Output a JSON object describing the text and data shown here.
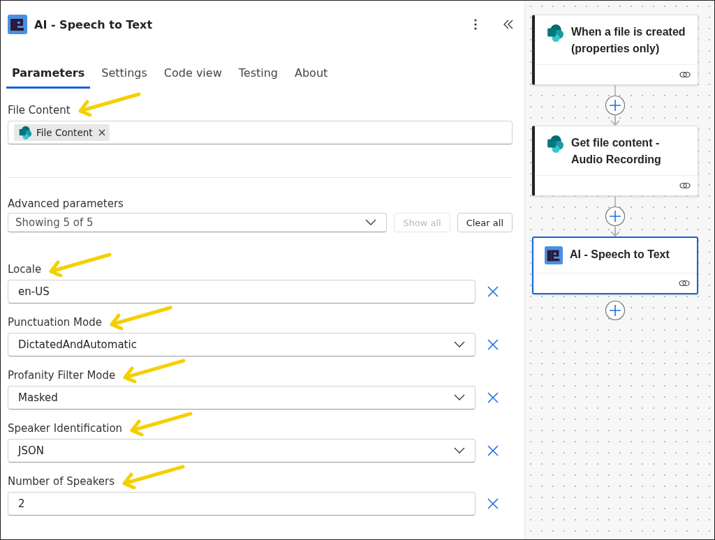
{
  "panel": {
    "title": "AI - Speech to Text"
  },
  "tabs": [
    {
      "label": "Parameters",
      "selected": true
    },
    {
      "label": "Settings",
      "selected": false
    },
    {
      "label": "Code view",
      "selected": false
    },
    {
      "label": "Testing",
      "selected": false
    },
    {
      "label": "About",
      "selected": false
    }
  ],
  "file_content": {
    "label": "File Content",
    "token": "File Content"
  },
  "advanced": {
    "label": "Advanced parameters",
    "value": "Showing 5 of 5",
    "show_all": {
      "label": "Show all",
      "disabled": true
    },
    "clear_all": {
      "label": "Clear all",
      "disabled": false
    }
  },
  "parameters": [
    {
      "label": "Locale",
      "kind": "text",
      "value": "en-US"
    },
    {
      "label": "Punctuation Mode",
      "kind": "dropdown",
      "value": "DictatedAndAutomatic"
    },
    {
      "label": "Profanity Filter Mode",
      "kind": "dropdown",
      "value": "Masked"
    },
    {
      "label": "Speaker Identification",
      "kind": "dropdown",
      "value": "JSON"
    },
    {
      "label": "Number of Speakers",
      "kind": "text",
      "value": "2"
    }
  ],
  "flow": [
    {
      "title": "When a file is created (properties only)",
      "kind": "connector",
      "selected": false
    },
    {
      "title": "Get file content - Audio Recording",
      "kind": "connector",
      "selected": false
    },
    {
      "title": "AI - Speech to Text",
      "kind": "ai",
      "selected": true
    }
  ]
}
